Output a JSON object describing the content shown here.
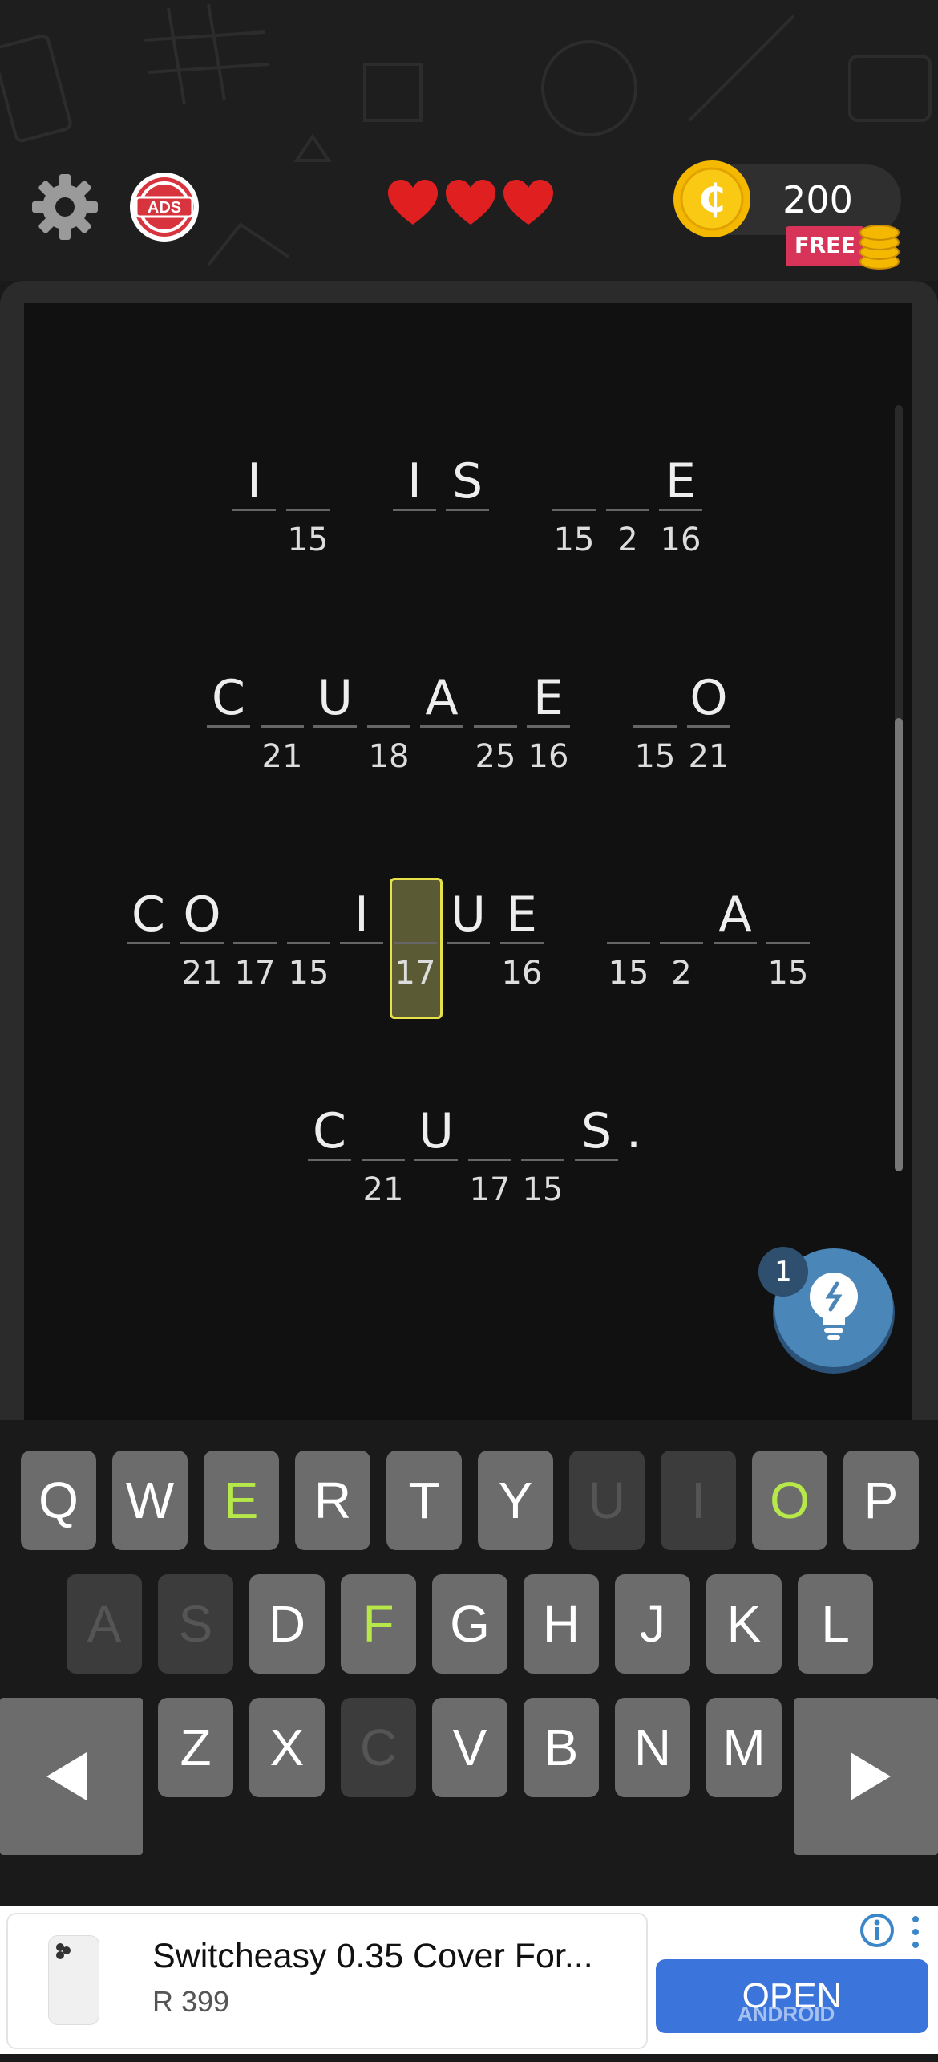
{
  "header": {
    "coins": "200",
    "free_label": "FREE",
    "ads_label": "ADS",
    "lives": 3
  },
  "puzzle": {
    "rows": [
      [
        [
          "I",
          ""
        ],
        [
          "",
          "15"
        ],
        null,
        [
          "I",
          ""
        ],
        [
          "S",
          ""
        ],
        null,
        [
          "",
          "15"
        ],
        [
          "",
          "2"
        ],
        [
          "E",
          "16"
        ]
      ],
      [
        [
          "C",
          ""
        ],
        [
          "",
          "21"
        ],
        [
          "U",
          ""
        ],
        [
          "",
          "18"
        ],
        [
          "A",
          ""
        ],
        [
          "",
          "25"
        ],
        [
          "E",
          "16"
        ],
        null,
        [
          "",
          "15"
        ],
        [
          "O",
          "21"
        ]
      ],
      [
        [
          "C",
          ""
        ],
        [
          "O",
          "21"
        ],
        [
          "",
          "17"
        ],
        [
          "",
          "15"
        ],
        [
          "I",
          ""
        ],
        [
          "",
          "17"
        ],
        [
          "U",
          ""
        ],
        [
          "E",
          "16"
        ],
        null,
        [
          "",
          "15"
        ],
        [
          "",
          "2"
        ],
        [
          "A",
          ""
        ],
        [
          "",
          "15"
        ]
      ],
      [
        [
          "C",
          ""
        ],
        [
          "",
          "21"
        ],
        [
          "U",
          ""
        ],
        [
          "",
          "17"
        ],
        [
          "",
          "15"
        ],
        [
          "S",
          ""
        ]
      ]
    ],
    "row4_punctuation": ".",
    "selected_number": "17"
  },
  "hint": {
    "count": "1"
  },
  "keyboard": {
    "row1": [
      "Q",
      "W",
      "E",
      "R",
      "T",
      "Y",
      "U",
      "I",
      "O",
      "P"
    ],
    "row2": [
      "A",
      "S",
      "D",
      "F",
      "G",
      "H",
      "J",
      "K",
      "L"
    ],
    "row3": [
      "Z",
      "X",
      "C",
      "V",
      "B",
      "N",
      "M"
    ],
    "used": [
      "U",
      "I",
      "A",
      "S",
      "C"
    ],
    "found": [
      "E",
      "O",
      "F"
    ]
  },
  "ad": {
    "title": "Switcheasy 0.35 Cover For...",
    "price": "R 399",
    "cta": "OPEN"
  },
  "watermark": "ANDROID AUTHORITY",
  "colors": {
    "background": "#111111",
    "selected_outline": "#e8e24a",
    "found_letter": "#b6e84a",
    "heart": "#e02020",
    "coin": "#f5b800",
    "ad_button": "#3b74db"
  }
}
